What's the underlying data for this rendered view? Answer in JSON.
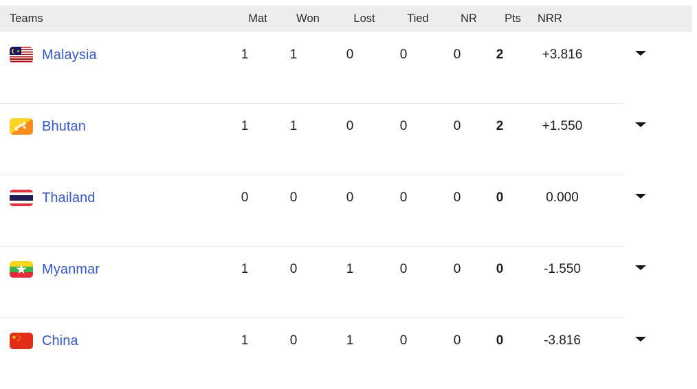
{
  "table": {
    "columns": [
      {
        "key": "team",
        "label": "Teams"
      },
      {
        "key": "mat",
        "label": "Mat"
      },
      {
        "key": "won",
        "label": "Won"
      },
      {
        "key": "lost",
        "label": "Lost"
      },
      {
        "key": "tied",
        "label": "Tied"
      },
      {
        "key": "nr",
        "label": "NR"
      },
      {
        "key": "pts",
        "label": "Pts"
      },
      {
        "key": "nrr",
        "label": "NRR"
      }
    ],
    "rows": [
      {
        "team": "Malaysia",
        "flag": "flag-malaysia",
        "mat": "1",
        "won": "1",
        "lost": "0",
        "tied": "0",
        "nr": "0",
        "pts": "2",
        "nrr": "+3.816",
        "expand_icon": "chevron-down-icon"
      },
      {
        "team": "Bhutan",
        "flag": "flag-bhutan",
        "mat": "1",
        "won": "1",
        "lost": "0",
        "tied": "0",
        "nr": "0",
        "pts": "2",
        "nrr": "+1.550",
        "expand_icon": "chevron-down-icon"
      },
      {
        "team": "Thailand",
        "flag": "flag-thailand",
        "mat": "0",
        "won": "0",
        "lost": "0",
        "tied": "0",
        "nr": "0",
        "pts": "0",
        "nrr": "0.000",
        "expand_icon": "chevron-down-icon"
      },
      {
        "team": "Myanmar",
        "flag": "flag-myanmar",
        "mat": "1",
        "won": "0",
        "lost": "1",
        "tied": "0",
        "nr": "0",
        "pts": "0",
        "nrr": "-1.550",
        "expand_icon": "chevron-down-icon"
      },
      {
        "team": "China",
        "flag": "flag-china",
        "mat": "1",
        "won": "0",
        "lost": "1",
        "tied": "0",
        "nr": "0",
        "pts": "0",
        "nrr": "-3.816",
        "expand_icon": "chevron-down-icon"
      }
    ]
  },
  "colors": {
    "team_link": "#3457d5",
    "header_bg": "#ededed",
    "text": "#1d1d1d",
    "separator": "#e9e9e9"
  }
}
